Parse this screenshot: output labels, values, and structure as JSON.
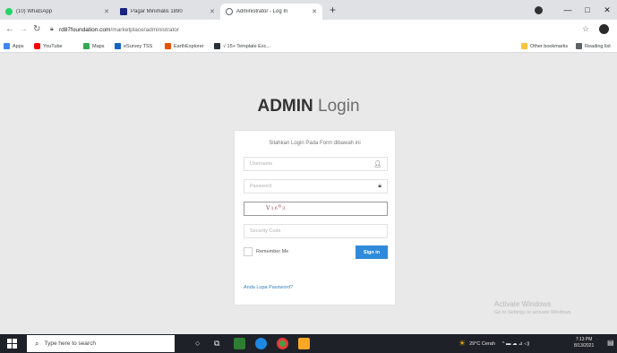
{
  "browser": {
    "tabs": [
      {
        "label": "(10) WhatsApp",
        "favicon_color": "#25d366",
        "active": false
      },
      {
        "label": "Pagar Minimalis 1890",
        "favicon_color": "#1a237e",
        "active": false
      },
      {
        "label": "Administrator - Log In",
        "favicon_color": "#5f6368",
        "active": true
      }
    ],
    "new_tab_glyph": "+",
    "window_controls": [
      "—",
      "□",
      "✕"
    ],
    "url_host": "rd87foundation.com",
    "url_path": "/marketplace/administrator",
    "bookmarks": [
      {
        "label": "Apps",
        "icon_color": "#4285f4"
      },
      {
        "label": "YouTube",
        "icon_color": "#ff0000"
      },
      {
        "label": "Maps",
        "icon_color": "#34a853"
      },
      {
        "label": "eSurvey TSS",
        "icon_color": "#1565c0"
      },
      {
        "label": "EarthExplorer",
        "icon_color": "#e65100"
      },
      {
        "label": "√ 15+ Template Exc...",
        "icon_color": "#263238"
      }
    ],
    "bookmarks_right": [
      {
        "label": "Other bookmarks",
        "icon_color": "#f9c33b"
      },
      {
        "label": "Reading list",
        "icon_color": "#5f6368"
      }
    ]
  },
  "login": {
    "title_bold": "ADMIN",
    "title_light": "Login",
    "heading": "Silahkan Login Pada Form dibawah ini",
    "username_placeholder": "Username",
    "password_placeholder": "Password",
    "captcha_text": "v₁₆⁶₃",
    "security_placeholder": "Security Code",
    "remember_label": "Remember Me",
    "signin_label": "Sign in",
    "forgot_label": "Anda Lupa Password?"
  },
  "watermark": {
    "line1": "Activate Windows",
    "line2": "Go to Settings to activate Windows."
  },
  "taskbar": {
    "search_placeholder": "Type here to search",
    "weather": "29°C Cerah",
    "tray_icons": "^ ▬ ☁ ⊿ ◁)",
    "time": "7:13 PM",
    "date": "8/13/2021"
  }
}
